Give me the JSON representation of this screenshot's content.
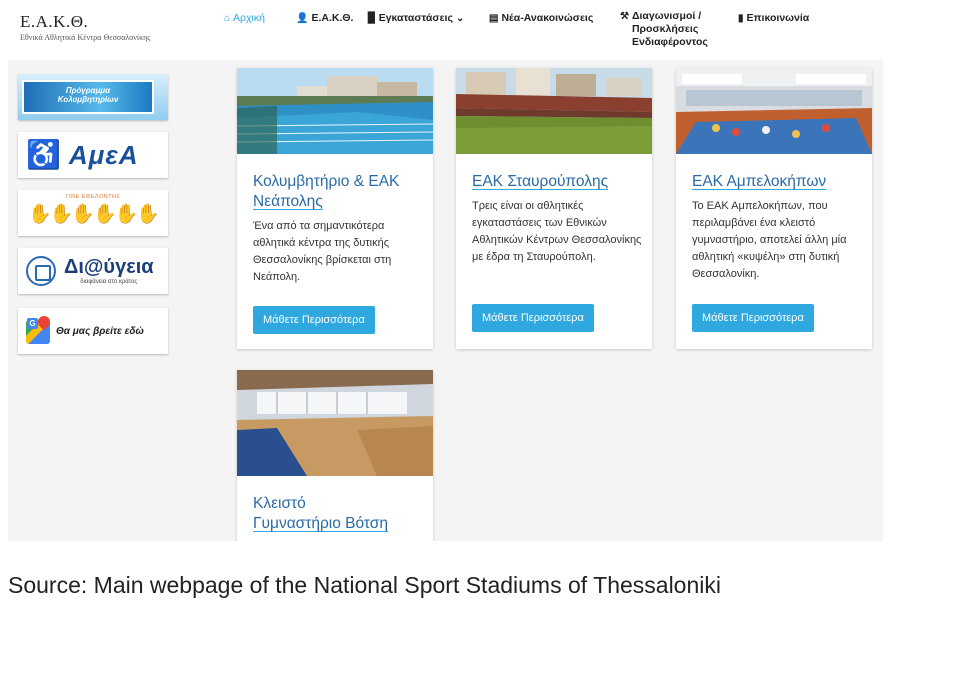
{
  "brand": {
    "title": "Ε.Α.Κ.Θ.",
    "subtitle": "Εθνικά Αθλητικά Κέντρα Θεσσαλονίκης"
  },
  "nav": {
    "items": [
      {
        "label": "Αρχική",
        "icon": "home-icon",
        "active": true
      },
      {
        "label": "Ε.Α.Κ.Θ.",
        "icon": "user-icon"
      },
      {
        "label": "Εγκαταστάσεις",
        "icon": "building-icon",
        "has_dropdown": true
      },
      {
        "label": "Νέα-Ανακοινώσεις",
        "icon": "newspaper-icon"
      },
      {
        "label_lines": [
          "Διαγωνισμοί /",
          "Προσκλήσεις",
          "Ενδιαφέροντος"
        ],
        "icon": "gavel-icon"
      },
      {
        "label": "Επικοινωνία",
        "icon": "document-icon"
      }
    ]
  },
  "sidebar": {
    "banners": [
      {
        "name": "swim-program",
        "lines": [
          "Πρόγραμμα",
          "Κολυμβητηρίων"
        ]
      },
      {
        "name": "amea",
        "text": "ΑμεΑ",
        "icon": "wheelchair-icon"
      },
      {
        "name": "volunteer",
        "text": "ΓΙΝΕ ΕΘΕΛΟΝΤΗΣ"
      },
      {
        "name": "diavgeia",
        "text": "Δι@ύγεια",
        "sub": "διαφάνεια στο κράτος",
        "icon": "seal-icon"
      },
      {
        "name": "maps",
        "text": "Θα μας βρείτε εδώ",
        "icon": "google-maps-icon"
      }
    ]
  },
  "cards": [
    {
      "title_lines": [
        "Κολυμβητήριο & ΕΑΚ",
        "Νεάπολης"
      ],
      "text": "Ένα από τα σημαντικότερα αθλητικά κέντρα της δυτικής Θεσσαλονίκης βρίσκεται στη Νεάπολη.",
      "button": "Μάθετε Περισσότερα"
    },
    {
      "title_lines": [
        "ΕΑΚ Σταυρούπολης"
      ],
      "text": "Τρεις είναι οι αθλητικές εγκαταστάσεις των Εθνικών Αθλητικών Κέντρων Θεσσαλονίκης με έδρα τη Σταυρούπολη.",
      "button": "Μάθετε Περισσότερα"
    },
    {
      "title_lines": [
        "ΕΑΚ Αμπελοκήπων"
      ],
      "text": "Το ΕΑΚ Αμπελοκήπων, που περιλαμβάνει ένα κλειστό γυμναστήριο, αποτελεί άλλη μία αθλητική «κυψέλη» στη δυτική Θεσσαλονίκη.",
      "button": "Μάθετε Περισσότερα"
    },
    {
      "title_lines": [
        "Κλειστό",
        "Γυμναστήριο Βότση"
      ]
    }
  ],
  "caption": "Source: Main webpage of the National Sport Stadiums of Thessaloniki",
  "colors": {
    "accent": "#2ea8df",
    "title": "#2a6aa8",
    "background": "#f4f4f4"
  }
}
